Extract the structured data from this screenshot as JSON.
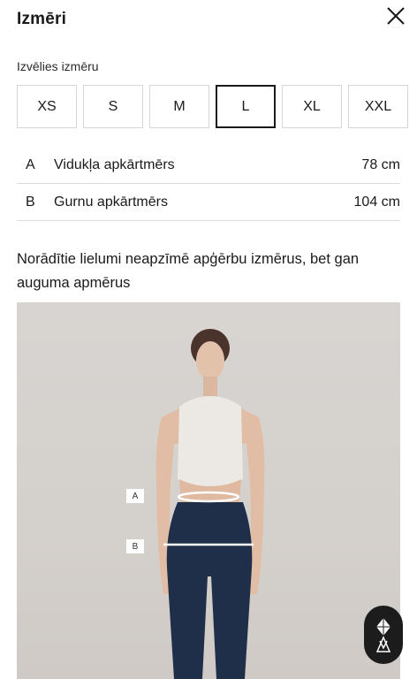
{
  "header": {
    "title": "Izmēri",
    "close_icon": "close-icon"
  },
  "size_picker": {
    "label": "Izvēlies izmēru",
    "sizes": [
      "XS",
      "S",
      "M",
      "L",
      "XL",
      "XXL"
    ],
    "selected": "L"
  },
  "measurements": [
    {
      "letter": "A",
      "name": "Vidukļa apkārtmērs",
      "value": "78 cm"
    },
    {
      "letter": "B",
      "name": "Gurnu apkārtmērs",
      "value": "104 cm"
    }
  ],
  "note": "Norādītie lielumi neapzīmē apģērbu izmērus, bet gan auguma apmērus",
  "figure": {
    "marker_a": "A",
    "marker_b": "B"
  },
  "chat_button": {
    "icon": "diamond-logo-icon"
  }
}
